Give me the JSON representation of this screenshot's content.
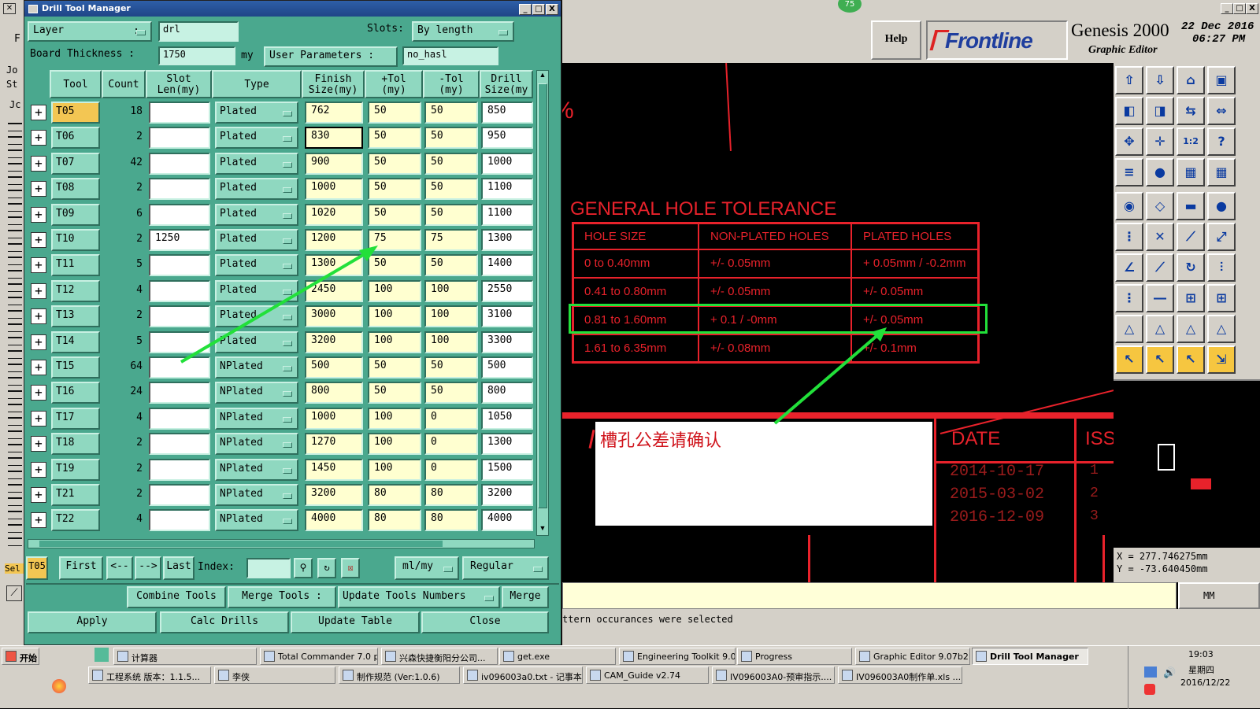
{
  "dtm": {
    "title": "Drill Tool Manager",
    "win_min": "_",
    "win_max": "□",
    "win_close": "X",
    "layer_label": "Layer",
    "layer_colon": ":",
    "layer_value": "drl",
    "slots_label": "Slots:",
    "slots_value": "By length",
    "board_thickness_label": "Board Thickness :",
    "board_thickness_value": "1750",
    "board_thickness_unit": "my",
    "user_params_label": "User Parameters :",
    "user_params_value": "no_hasl",
    "headers": {
      "tool": "Tool",
      "count": "Count",
      "slot_len": "Slot\nLen(my)",
      "type": "Type",
      "finish": "Finish\nSize(my)",
      "ptol": "+Tol\n(my)",
      "mtol": "-Tol\n(my)",
      "drill": "Drill\nSize(my"
    },
    "rows": [
      {
        "tool": "T05",
        "count": "18",
        "slot": "",
        "type": "Plated",
        "finish": "762",
        "ptol": "50",
        "mtol": "50",
        "drill": "850"
      },
      {
        "tool": "T06",
        "count": "2",
        "slot": "",
        "type": "Plated",
        "finish": "830",
        "ptol": "50",
        "mtol": "50",
        "drill": "950"
      },
      {
        "tool": "T07",
        "count": "42",
        "slot": "",
        "type": "Plated",
        "finish": "900",
        "ptol": "50",
        "mtol": "50",
        "drill": "1000"
      },
      {
        "tool": "T08",
        "count": "2",
        "slot": "",
        "type": "Plated",
        "finish": "1000",
        "ptol": "50",
        "mtol": "50",
        "drill": "1100"
      },
      {
        "tool": "T09",
        "count": "6",
        "slot": "",
        "type": "Plated",
        "finish": "1020",
        "ptol": "50",
        "mtol": "50",
        "drill": "1100"
      },
      {
        "tool": "T10",
        "count": "2",
        "slot": "1250",
        "type": "Plated",
        "finish": "1200",
        "ptol": "75",
        "mtol": "75",
        "drill": "1300"
      },
      {
        "tool": "T11",
        "count": "5",
        "slot": "",
        "type": "Plated",
        "finish": "1300",
        "ptol": "50",
        "mtol": "50",
        "drill": "1400"
      },
      {
        "tool": "T12",
        "count": "4",
        "slot": "",
        "type": "Plated",
        "finish": "2450",
        "ptol": "100",
        "mtol": "100",
        "drill": "2550"
      },
      {
        "tool": "T13",
        "count": "2",
        "slot": "",
        "type": "Plated",
        "finish": "3000",
        "ptol": "100",
        "mtol": "100",
        "drill": "3100"
      },
      {
        "tool": "T14",
        "count": "5",
        "slot": "",
        "type": "Plated",
        "finish": "3200",
        "ptol": "100",
        "mtol": "100",
        "drill": "3300"
      },
      {
        "tool": "T15",
        "count": "64",
        "slot": "",
        "type": "NPlated",
        "finish": "500",
        "ptol": "50",
        "mtol": "50",
        "drill": "500"
      },
      {
        "tool": "T16",
        "count": "24",
        "slot": "",
        "type": "NPlated",
        "finish": "800",
        "ptol": "50",
        "mtol": "50",
        "drill": "800"
      },
      {
        "tool": "T17",
        "count": "4",
        "slot": "",
        "type": "NPlated",
        "finish": "1000",
        "ptol": "100",
        "mtol": "0",
        "drill": "1050"
      },
      {
        "tool": "T18",
        "count": "2",
        "slot": "",
        "type": "NPlated",
        "finish": "1270",
        "ptol": "100",
        "mtol": "0",
        "drill": "1300"
      },
      {
        "tool": "T19",
        "count": "2",
        "slot": "",
        "type": "NPlated",
        "finish": "1450",
        "ptol": "100",
        "mtol": "0",
        "drill": "1500"
      },
      {
        "tool": "T21",
        "count": "2",
        "slot": "",
        "type": "NPlated",
        "finish": "3200",
        "ptol": "80",
        "mtol": "80",
        "drill": "3200"
      },
      {
        "tool": "T22",
        "count": "4",
        "slot": "",
        "type": "NPlated",
        "finish": "4000",
        "ptol": "80",
        "mtol": "80",
        "drill": "4000"
      }
    ],
    "current_tool": "T05",
    "nav": {
      "first": "First",
      "prev": "<--",
      "next": "-->",
      "last": "Last",
      "index_label": "Index:",
      "units": "ml/my",
      "mode": "Regular"
    },
    "actions": {
      "combine": "Combine Tools",
      "merge_tools": "Merge Tools :",
      "update_numbers": "Update Tools Numbers",
      "merge": "Merge",
      "apply": "Apply",
      "calc": "Calc Drills",
      "update_table": "Update Table",
      "close": "Close"
    }
  },
  "genesis": {
    "help": "Help",
    "brand": "Frontline",
    "app": "Genesis 2000",
    "sub": "Graphic Editor",
    "date": "22 Dec 2016",
    "time": "06:27 PM",
    "badge": "75",
    "coord_x": "X = 277.746275mm",
    "coord_y": "Y = -73.640450mm",
    "units": "MM",
    "status": "ttern occurances were selected"
  },
  "drawing": {
    "percent": "%",
    "table_title": "GENERAL HOLE TOLERANCE",
    "cols": [
      "HOLE SIZE",
      "NON-PLATED HOLES",
      "PLATED HOLES"
    ],
    "rows": [
      [
        "0  to  0.40mm",
        "+/- 0.05mm",
        "+ 0.05mm / -0.2mm"
      ],
      [
        "0.41  to  0.80mm",
        "+/- 0.05mm",
        "+/- 0.05mm"
      ],
      [
        "0.81  to 1.60mm",
        "+ 0.1 / -0mm",
        "+/- 0.05mm"
      ],
      [
        "1.61  to  6.35mm",
        "+/- 0.08mm",
        "+/- 0.1mm"
      ]
    ],
    "note": "槽孔公差请确认",
    "date_label": "DATE",
    "iss_label": "ISS",
    "dates": [
      "2014-10-17",
      "2015-03-02",
      "2016-12-09"
    ],
    "issues": [
      "1",
      "2",
      "3"
    ]
  },
  "left_strip": {
    "f": "F",
    "jo": "Jo",
    "st": "St",
    "jc": "Jc",
    "sel": "Sel"
  },
  "taskbar": {
    "start": "开始",
    "row1": [
      "计算器",
      "Total Commander 7.0 p...",
      "兴森快捷衡阳分公司...",
      "get.exe",
      "Engineering Toolkit 9.0...",
      "Progress",
      "Graphic Editor 9.07b2 (...",
      "Drill Tool Manager"
    ],
    "row2": [
      "工程系统  版本：1.1.5...",
      "李侠",
      "制作规范 (Ver:1.0.6)",
      "iv096003a0.txt - 记事本",
      "CAM_Guide v2.74",
      "IV096003A0-预审指示....",
      "IV096003A0制作单.xls ..."
    ],
    "clock": "19:03",
    "weekday": "星期四",
    "date": "2016/12/22"
  },
  "colors": {
    "accent_green": "#22e03a",
    "drawing_red": "#e8222b",
    "panel_teal": "#4aa88e"
  }
}
